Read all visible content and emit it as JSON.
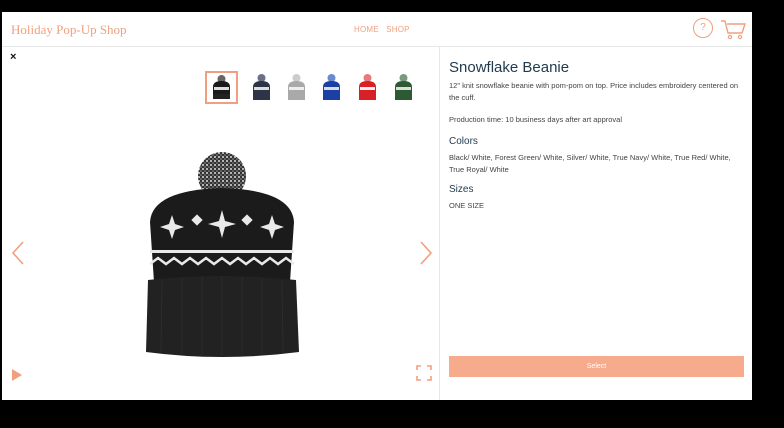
{
  "header": {
    "brand": "Holiday Pop-Up Shop",
    "nav": [
      "HOME",
      "SHOP"
    ],
    "help_label": "?"
  },
  "viewer": {
    "close_label": "×",
    "thumbnails": [
      {
        "color": "#1a1a1a",
        "selected": true
      },
      {
        "color": "#2e3448",
        "selected": false
      },
      {
        "color": "#a9a9a9",
        "selected": false
      },
      {
        "color": "#1c3fa3",
        "selected": false
      },
      {
        "color": "#d62226",
        "selected": false
      },
      {
        "color": "#2d5a35",
        "selected": false
      }
    ]
  },
  "product": {
    "title": "Snowflake Beanie",
    "description": "12\" knit snowflake beanie with pom-pom on top. Price includes embroidery centered on the cuff.",
    "production": "Production time: 10 business days after art approval",
    "colors_heading": "Colors",
    "colors_text": "Black/ White, Forest Green/ White, Silver/ White, True Navy/ White, True Red/ White, True Royal/ White",
    "sizes_heading": "Sizes",
    "sizes_text": "ONE SIZE",
    "select_label": "Select"
  },
  "accent_color": "#f0a07e"
}
